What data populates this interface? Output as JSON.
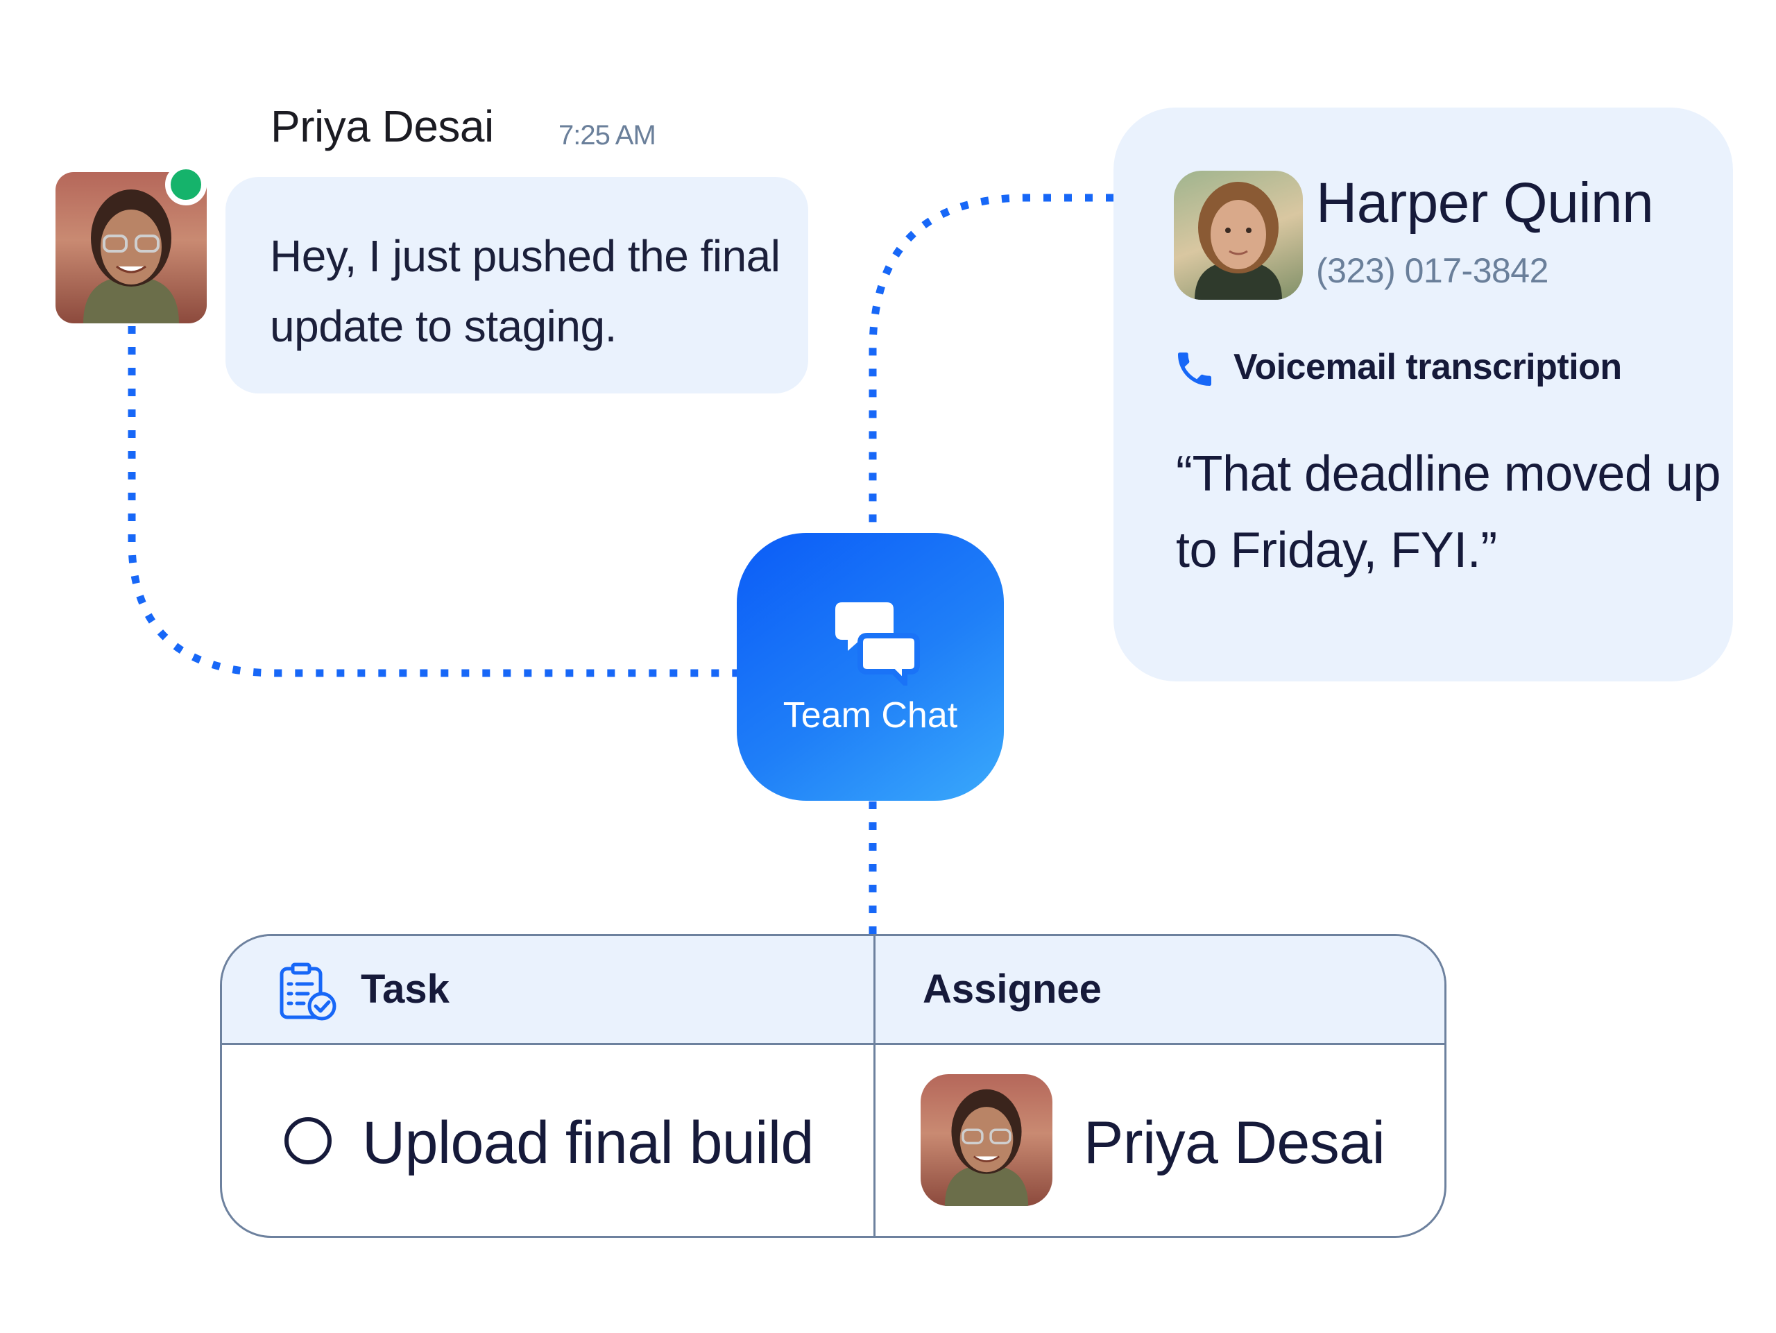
{
  "chat_message": {
    "sender": "Priya Desai",
    "time": "7:25 AM",
    "text": "Hey, I just pushed the final update to staging.",
    "presence": "online"
  },
  "voicemail": {
    "caller_name": "Harper Quinn",
    "caller_phone": "(323) 017-3842",
    "label": "Voicemail transcription",
    "transcript": "“That deadline moved up to Friday, FYI.”"
  },
  "hub": {
    "label": "Team Chat"
  },
  "task_table": {
    "headers": {
      "task": "Task",
      "assignee": "Assignee"
    },
    "rows": [
      {
        "task": "Upload final build",
        "assignee": "Priya Desai",
        "done": false
      }
    ]
  },
  "colors": {
    "accent": "#1767f7",
    "bubble_bg": "#eaf2fd",
    "presence": "#15b36b",
    "text_dark": "#161a3a",
    "text_muted": "#6a7f9a",
    "border": "#6d819e"
  },
  "icons": [
    "team-chat-icon",
    "phone-icon",
    "task-clipboard-icon",
    "checkbox-circle-icon"
  ]
}
